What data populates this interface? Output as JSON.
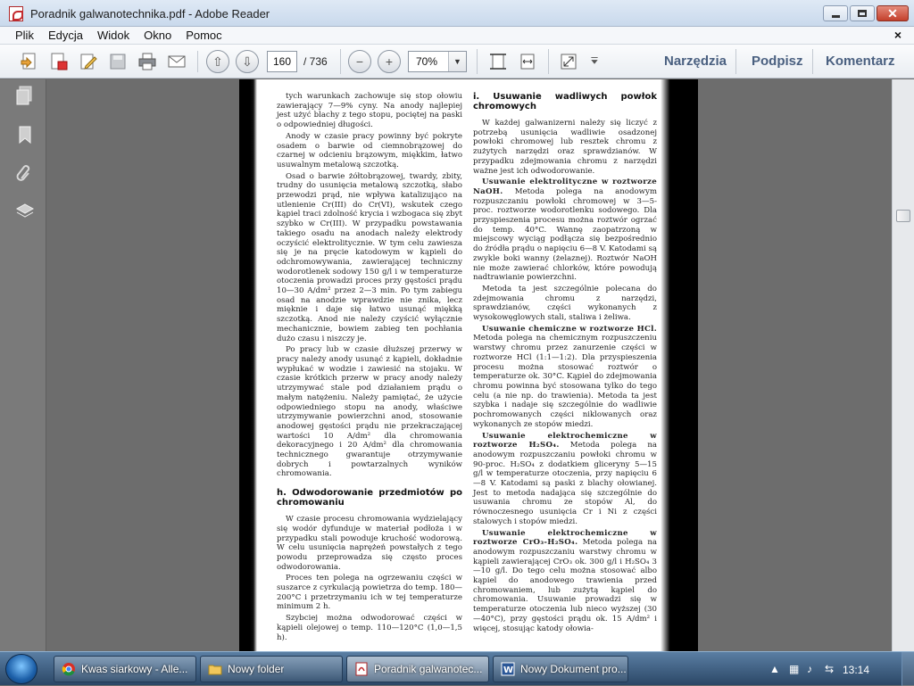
{
  "window": {
    "title": "Poradnik galwanotechnika.pdf - Adobe Reader"
  },
  "menu": {
    "items": [
      "Plik",
      "Edycja",
      "Widok",
      "Okno",
      "Pomoc"
    ],
    "close_glyph": "×"
  },
  "toolbar": {
    "page_current": "160",
    "page_total": "/ 736",
    "zoom": "70%",
    "links": [
      "Narzędzia",
      "Podpisz",
      "Komentarz"
    ]
  },
  "document": {
    "left_column": [
      {
        "type": "p",
        "text": "tych warunkach zachowuje się stop ołowiu zawierający 7—9% cyny. Na anody najlepiej jest użyć blachy z tego stopu, pociętej na paski o odpowiedniej długości."
      },
      {
        "type": "p",
        "text": "Anody w czasie pracy powinny być pokryte osadem o barwie od ciemnobrązowej do czarnej w odcieniu brązowym, miękkim, łatwo usuwalnym metalową szczotką."
      },
      {
        "type": "p",
        "text": "Osad o barwie żółtobrązowej, twardy, zbity, trudny do usunięcia metalową szczotką, słabo przewodzi prąd, nie wpływa katalizująco na utlenienie Cr(III) do Cr(VI), wskutek czego kąpiel traci zdolność krycia i wzbogaca się zbyt szybko w Cr(III). W przypadku powstawania takiego osadu na anodach należy elektrody oczyścić elektrolitycznie. W tym celu zawiesza się je na pręcie katodowym w kąpieli do odchromowywania, zawierającej techniczny wodorotlenek sodowy 150 g/l i w temperaturze otoczenia prowadzi proces przy gęstości prądu 10—30 A/dm² przez 2—3 min. Po tym zabiegu osad na anodzie wprawdzie nie znika, lecz mięknie i daje się łatwo usunąć miękką szczotką. Anod nie należy czyścić wyłącznie mechanicznie, bowiem zabieg ten pochłania dużo czasu i niszczy je."
      },
      {
        "type": "p",
        "text": "Po pracy lub w czasie dłuższej przerwy w pracy należy anody usunąć z kąpieli, dokładnie wypłukać w wodzie i zawiesić na stojaku. W czasie krótkich przerw w pracy anody należy utrzymywać stale pod działaniem prądu o małym natężeniu. Należy pamiętać, że użycie odpowiedniego stopu na anody, właściwe utrzymywanie powierzchni anod, stosowanie anodowej gęstości prądu nie przekraczającej wartości 10 A/dm² dla chromowania dekoracyjnego i 20 A/dm² dla chromowania technicznego gwarantuje otrzymywanie dobrych i powtarzalnych wyników chromowania."
      },
      {
        "type": "head",
        "text": "h. Odwodorowanie przedmiotów po chromowaniu"
      },
      {
        "type": "p",
        "text": "W czasie procesu chromowania wydzielający się wodór dyfunduje w materiał podłoża i w przypadku stali powoduje kruchość wodorową. W celu usunięcia naprężeń powstałych z tego powodu przeprowadza się często proces odwodorowania."
      },
      {
        "type": "p",
        "text": "Proces ten polega na ogrzewaniu części w suszarce z cyrkulacją powietrza do temp. 180—200°C i przetrzymaniu ich w tej temperaturze minimum 2 h."
      },
      {
        "type": "p",
        "text": "Szybciej można odwodorować części w kąpieli olejowej o temp. 110—120°C (1,0—1,5 h)."
      }
    ],
    "right_column": [
      {
        "type": "head",
        "text": "i. Usuwanie wadliwych powłok chromowych"
      },
      {
        "type": "p",
        "text": "W każdej galwanizerni należy się liczyć z potrzebą usunięcia wadliwie osadzonej powłoki chromowej lub resztek chromu z zużytych narzędzi oraz sprawdzianów. W przypadku zdejmowania chromu z narzędzi ważne jest ich odwodorowanie."
      },
      {
        "type": "sp",
        "lead": "Usuwanie elektrolityczne w roztworze NaOH.",
        "text": " Metoda polega na anodowym rozpuszczaniu powłoki chromowej w 3—5-proc. roztworze wodorotlenku sodowego. Dla przyspieszenia procesu można roztwór ogrzać do temp. 40°C. Wannę zaopatrzoną w miejscowy wyciąg podłącza się bezpośrednio do źródła prądu o napięciu 6—8 V. Katodami są zwykle boki wanny (żelaznej). Roztwór NaOH nie może zawierać chlorków, które powodują nadtrawianie powierzchni."
      },
      {
        "type": "p",
        "text": "Metoda ta jest szczególnie polecana do zdejmowania chromu z narzędzi, sprawdzianów, części wykonanych z wysokowęglowych stali, staliwa i żeliwa."
      },
      {
        "type": "sp",
        "lead": "Usuwanie chemiczne w roztworze HCl.",
        "text": " Metoda polega na chemicznym rozpuszczeniu warstwy chromu przez zanurzenie części w roztworze HCl (1:1—1:2). Dla przyspieszenia procesu można stosować roztwór o temperaturze ok. 30°C. Kąpiel do zdejmowania chromu powinna być stosowana tylko do tego celu (a nie np. do trawienia). Metoda ta jest szybka i nadaje się szczególnie do wadliwie pochromowanych części niklowanych oraz wykonanych ze stopów miedzi."
      },
      {
        "type": "sp",
        "lead": "Usuwanie elektrochemiczne w roztworze H₂SO₄.",
        "text": " Metoda polega na anodowym rozpuszczaniu powłoki chromu w 90-proc. H₂SO₄ z dodatkiem gliceryny 5—15 g/l w temperaturze otoczenia, przy napięciu 6—8 V. Katodami są paski z blachy ołowianej. Jest to metoda nadająca się szczególnie do usuwania chromu ze stopów Al, do równoczesnego usunięcia Cr i Ni z części stalowych i stopów miedzi."
      },
      {
        "type": "sp",
        "lead": "Usuwanie elektrochemiczne w roztworze CrO₃-H₂SO₄.",
        "text": " Metoda polega na anodowym rozpuszczaniu warstwy chromu w kąpieli zawierającej CrO₃ ok. 300 g/l i H₂SO₄ 3—10 g/l. Do tego celu można stosować albo kąpiel do anodowego trawienia przed chromowaniem, lub zużytą kąpiel do chromowania. Usuwanie prowadzi się w temperaturze otoczenia lub nieco wyższej (30—40°C), przy gęstości prądu ok. 15 A/dm² i więcej, stosując katody ołowia-"
      }
    ]
  },
  "taskbar": {
    "items": [
      {
        "label": "Kwas siarkowy - Alle...",
        "icon": "chrome-icon"
      },
      {
        "label": "Nowy folder",
        "icon": "folder-icon"
      },
      {
        "label": "Poradnik galwanotec...",
        "icon": "pdf-icon"
      },
      {
        "label": "Nowy Dokument pro...",
        "icon": "word-icon"
      }
    ],
    "clock": "13:14"
  },
  "colors": {
    "title_bar": "#c9d9ec",
    "doc_background": "#6d6d6d",
    "link_text": "#4a6080",
    "taskbar": "#2b4766"
  }
}
